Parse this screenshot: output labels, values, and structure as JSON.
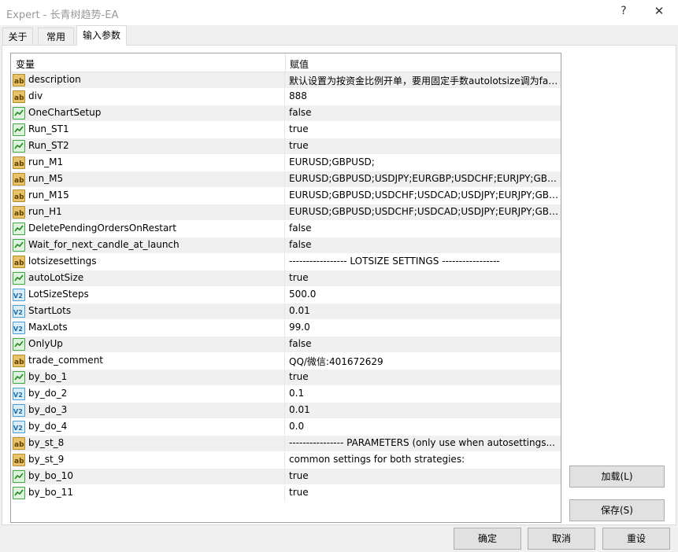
{
  "window": {
    "title": "Expert - 长青树趋势-EA",
    "help": "?",
    "close": "✕"
  },
  "tabs": [
    {
      "label": "关于",
      "active": false
    },
    {
      "label": "常用",
      "active": false
    },
    {
      "label": "输入参数",
      "active": true
    }
  ],
  "grid": {
    "col_variable": "变量",
    "col_value": "赋值",
    "rows": [
      {
        "type": "ab",
        "name": "description",
        "value": "默认设置为按资金比例开单，要用固定手数autolotsize调为false"
      },
      {
        "type": "ab",
        "name": "div",
        "value": "888"
      },
      {
        "type": "bool",
        "name": "OneChartSetup",
        "value": "false"
      },
      {
        "type": "bool",
        "name": "Run_ST1",
        "value": "true"
      },
      {
        "type": "bool",
        "name": "Run_ST2",
        "value": "true"
      },
      {
        "type": "ab",
        "name": "run_M1",
        "value": "EURUSD;GBPUSD;"
      },
      {
        "type": "ab",
        "name": "run_M5",
        "value": "EURUSD;GBPUSD;USDJPY;EURGBP;USDCHF;EURJPY;GBPJ..."
      },
      {
        "type": "ab",
        "name": "run_M15",
        "value": "EURUSD;GBPUSD;USDCHF;USDCAD;USDJPY;EURJPY;GBPJ..."
      },
      {
        "type": "ab",
        "name": "run_H1",
        "value": "EURUSD;GBPUSD;USDCHF;USDCAD;USDJPY;EURJPY;GBPJ..."
      },
      {
        "type": "bool",
        "name": "DeletePendingOrdersOnRestart",
        "value": "false"
      },
      {
        "type": "bool",
        "name": "Wait_for_next_candle_at_launch",
        "value": "false"
      },
      {
        "type": "ab",
        "name": "lotsizesettings",
        "value": "----------------- LOTSIZE SETTINGS -----------------"
      },
      {
        "type": "bool",
        "name": "autoLotSize",
        "value": "true"
      },
      {
        "type": "num",
        "name": "LotSizeSteps",
        "value": "500.0"
      },
      {
        "type": "num",
        "name": "StartLots",
        "value": "0.01"
      },
      {
        "type": "num",
        "name": "MaxLots",
        "value": "99.0"
      },
      {
        "type": "bool",
        "name": "OnlyUp",
        "value": "false"
      },
      {
        "type": "ab",
        "name": "trade_comment",
        "value": "QQ/微信:401672629"
      },
      {
        "type": "bool",
        "name": "by_bo_1",
        "value": "true"
      },
      {
        "type": "num",
        "name": "by_do_2",
        "value": "0.1"
      },
      {
        "type": "num",
        "name": "by_do_3",
        "value": "0.01"
      },
      {
        "type": "num",
        "name": "by_do_4",
        "value": "0.0"
      },
      {
        "type": "ab",
        "name": "by_st_8",
        "value": "---------------- PARAMETERS (only use when autosettings..."
      },
      {
        "type": "ab",
        "name": "by_st_9",
        "value": "common settings for both strategies:"
      },
      {
        "type": "bool",
        "name": "by_bo_10",
        "value": "true"
      },
      {
        "type": "bool",
        "name": "by_bo_11",
        "value": "true"
      }
    ]
  },
  "buttons": {
    "load": "加载(L)",
    "save": "保存(S)",
    "ok": "确定",
    "cancel": "取消",
    "reset": "重设"
  },
  "icons": {
    "ab": "string-param-icon",
    "bool": "bool-param-icon",
    "num": "double-param-icon"
  }
}
